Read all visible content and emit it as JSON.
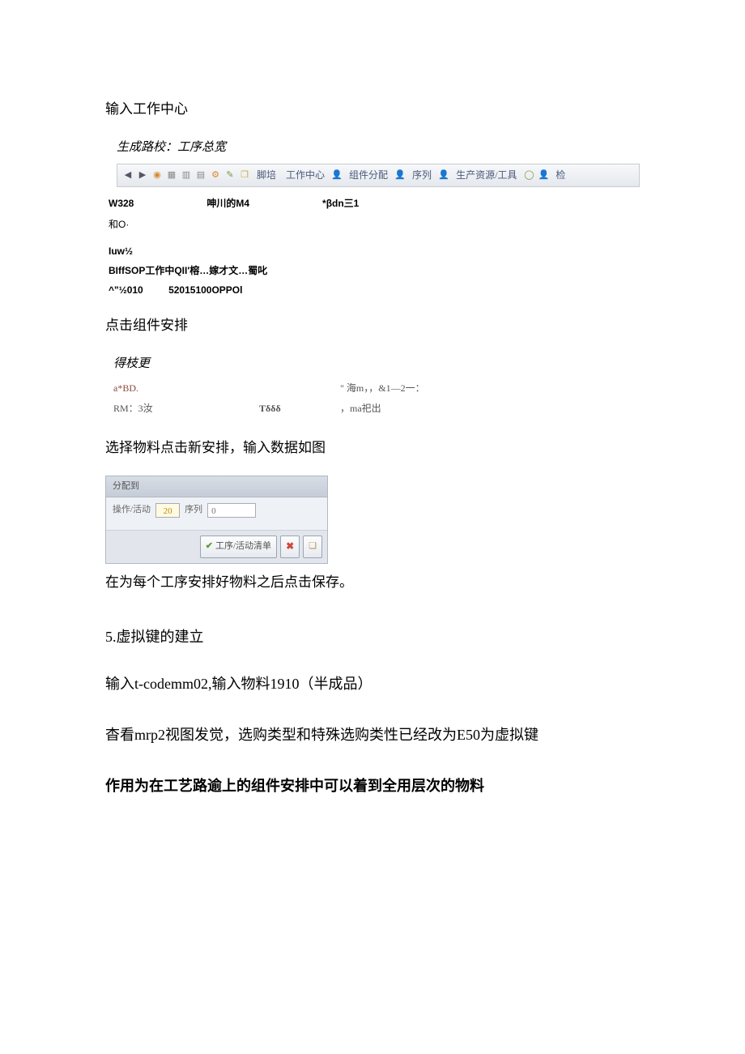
{
  "intro": {
    "line1": "输入工作中心",
    "caption1": "生成路校：工序总宽"
  },
  "toolbar": {
    "item_workcenter": "工作中心",
    "item_component": "组件分配",
    "item_sequence": "序列",
    "item_resource": "生产资源/工具",
    "item_check": "检"
  },
  "block1": {
    "r1a": "W328",
    "r1b": "呻川的M4",
    "r1c": "*βdn三1",
    "r2": "和O·",
    "r3": "Iuw½",
    "r4": "BIffSOP工作中QII'榕…嫁才文…蜀叱",
    "r5a": "^\"½010",
    "r5b": "52015100OPPOl"
  },
  "para2": "点击组件安排",
  "table1": {
    "head": "得枝更",
    "r1c1": "a*BD.",
    "r1c3": "\" 海m，，&1—2一：",
    "r2c1": "RM：3汝",
    "r2c2": "Tδδδ",
    "r2c3": "，ma祀出"
  },
  "para3": "选择物料点击新安排，输入数据如图",
  "dialog": {
    "header": "分配到",
    "label1": "操作/活动",
    "val1": "20",
    "label2": "序列",
    "val2": "0",
    "btn_ok": "工序/活动清单"
  },
  "para4": "在为每个工序安排好物料之后点击保存。",
  "section5": {
    "title": "5.虚拟键的建立",
    "line1": "输入t-codemm02,输入物料1910（半成品）",
    "line2": "杳看mrp2视图发觉，选购类型和特殊选购类性已经改为E50为虚拟键",
    "line3": "作用为在工艺路逾上的组件安排中可以着到全用层次的物料"
  }
}
